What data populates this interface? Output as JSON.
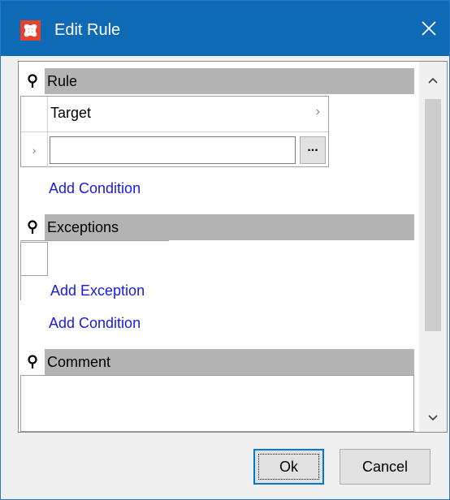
{
  "window": {
    "title": "Edit Rule",
    "icon": "app-logo-icon",
    "close_icon": "close-icon",
    "accent": "#0e6ab5"
  },
  "rule_section": {
    "header": "Rule",
    "pin_icon": "pin-icon",
    "grid": {
      "rows": [
        {
          "label": "Target",
          "arrow": "›"
        },
        {
          "row_marker": "›",
          "value": "",
          "browse_label": "..."
        }
      ]
    },
    "add_condition": "Add Condition"
  },
  "exceptions_section": {
    "header": "Exceptions",
    "add_exception": "Add Exception",
    "add_condition": "Add Condition"
  },
  "comment_section": {
    "header": "Comment",
    "value": ""
  },
  "buttons": {
    "ok": "Ok",
    "cancel": "Cancel"
  }
}
